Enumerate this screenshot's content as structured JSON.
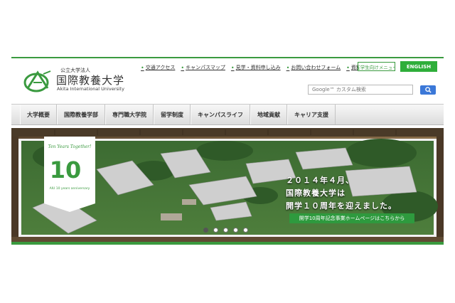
{
  "header": {
    "logo": {
      "corp_label": "公立大学法人",
      "name": "国際教養大学",
      "name_en": "Akita International University",
      "icon": "aiu-logo-mark"
    },
    "util_links": [
      {
        "label": "交通アクセス"
      },
      {
        "label": "キャンパスマップ"
      },
      {
        "label": "見学・資料申し込み"
      },
      {
        "label": "お問い合わせフォーム"
      },
      {
        "label": "資料請求"
      }
    ],
    "student_button": "在学生向けメニュー",
    "english_button": "ENGLISH",
    "search": {
      "placeholder": "Google™ カスタム検索",
      "button_icon": "search-icon"
    }
  },
  "nav": {
    "items": [
      {
        "label": "大学概要"
      },
      {
        "label": "国際教養学部"
      },
      {
        "label": "専門職大学院"
      },
      {
        "label": "留学制度"
      },
      {
        "label": "キャンパスライフ"
      },
      {
        "label": "地域貢献"
      },
      {
        "label": "キャリア支援"
      }
    ]
  },
  "hero": {
    "badge": {
      "script": "Ten Years Together!",
      "number": "10",
      "caption": "AIU 10 years anniversary"
    },
    "headline": [
      "２０１４年４月、",
      "国際教養大学は",
      "開学１０周年を迎えました。"
    ],
    "link": "開学10周年記念事業ホームページはこちらから",
    "slides": [
      {
        "active": true
      },
      {
        "active": false
      },
      {
        "active": false
      },
      {
        "active": false
      },
      {
        "active": false
      }
    ]
  },
  "colors": {
    "brand_green": "#3a9a3f",
    "english_button": "#2fae3a",
    "search_button": "#3b78d8"
  }
}
